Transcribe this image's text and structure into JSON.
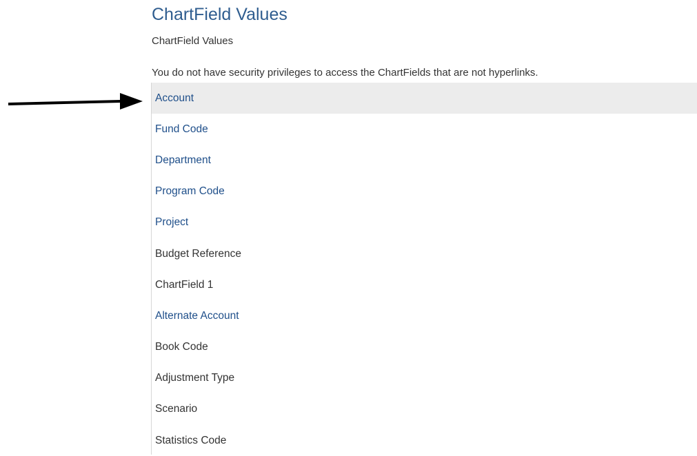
{
  "header": {
    "title": "ChartField Values",
    "subtitle": "ChartField Values"
  },
  "message": "You do not have security privileges to access the ChartFields that are not hyperlinks.",
  "chartfields": [
    {
      "label": "Account",
      "link": true,
      "selected": true
    },
    {
      "label": "Fund Code",
      "link": true,
      "selected": false
    },
    {
      "label": "Department",
      "link": true,
      "selected": false
    },
    {
      "label": "Program Code",
      "link": true,
      "selected": false
    },
    {
      "label": "Project",
      "link": true,
      "selected": false
    },
    {
      "label": "Budget Reference",
      "link": false,
      "selected": false
    },
    {
      "label": "ChartField 1",
      "link": false,
      "selected": false
    },
    {
      "label": "Alternate Account",
      "link": true,
      "selected": false
    },
    {
      "label": "Book Code",
      "link": false,
      "selected": false
    },
    {
      "label": "Adjustment Type",
      "link": false,
      "selected": false
    },
    {
      "label": "Scenario",
      "link": false,
      "selected": false
    },
    {
      "label": "Statistics Code",
      "link": false,
      "selected": false
    }
  ],
  "colors": {
    "title": "#2f5d8f",
    "link": "#1f4f8a",
    "text": "#333333",
    "selected_row": "#ececec",
    "arrow": "#000000"
  },
  "annotation": {
    "icon": "arrow-right-icon"
  }
}
